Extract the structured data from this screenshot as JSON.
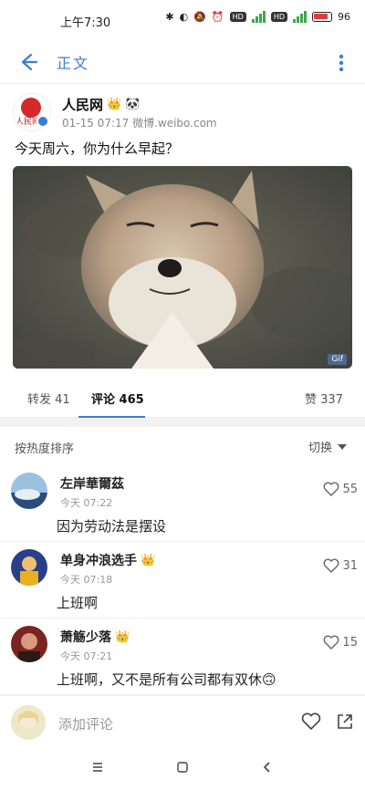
{
  "status": {
    "time": "上午7:30",
    "battery": "96"
  },
  "appbar": {
    "title": "正文"
  },
  "post": {
    "author": "人民网",
    "avatar_text": "人民网",
    "meta": "01-15 07:17  微博.weibo.com",
    "text": "今天周六，你为什么早起？",
    "gif_label": "Gif"
  },
  "tabs": {
    "repost": "转发 41",
    "comments": "评论 465",
    "likes": "赞 337"
  },
  "sort": {
    "label": "按热度排序",
    "switch": "切换"
  },
  "comments": [
    {
      "name": "左岸華爾茲",
      "time": "今天 07:22",
      "text": "因为劳动法是摆设",
      "likes": "55"
    },
    {
      "name": "单身冲浪选手",
      "time": "今天 07:18",
      "text": "上班啊",
      "likes": "31"
    },
    {
      "name": "萧觞少落",
      "time": "今天 07:21",
      "text": "上班啊，又不是所有公司都有双休🙃",
      "likes": "15"
    }
  ],
  "input": {
    "placeholder": "添加评论"
  }
}
